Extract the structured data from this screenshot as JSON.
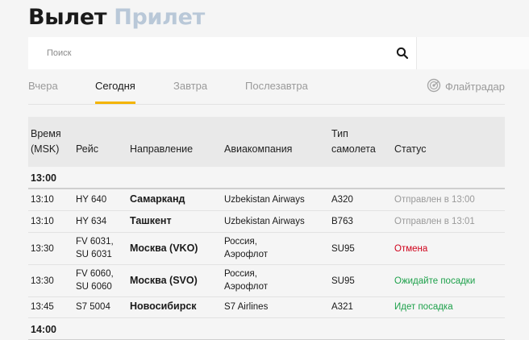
{
  "header": {
    "departures": "Вылет",
    "arrivals": "Прилет"
  },
  "search": {
    "placeholder": "Поиск"
  },
  "tabs": [
    {
      "label": "Вчера"
    },
    {
      "label": "Сегодня"
    },
    {
      "label": "Завтра"
    },
    {
      "label": "Послезавтра"
    }
  ],
  "flightradar": {
    "label": "Флайтрадар"
  },
  "table": {
    "columns": {
      "time_line1": "Время",
      "time_line2": "(MSK)",
      "flight": "Рейс",
      "destination": "Направление",
      "airline": "Авиакомпания",
      "aircraft_line1": "Тип",
      "aircraft_line2": "самолета",
      "status": "Статус"
    },
    "groups": [
      {
        "label": "13:00"
      },
      {
        "label": "14:00"
      }
    ],
    "rows": [
      {
        "time": "13:10",
        "flight_1": "HY 640",
        "flight_2": "",
        "destination": "Самарканд",
        "airline_1": "Uzbekistan Airways",
        "airline_2": "",
        "aircraft": "A320",
        "status": "Отправлен в 13:00"
      },
      {
        "time": "13:10",
        "flight_1": "HY 634",
        "flight_2": "",
        "destination": "Ташкент",
        "airline_1": "Uzbekistan Airways",
        "airline_2": "",
        "aircraft": "B763",
        "status": "Отправлен в 13:01"
      },
      {
        "time": "13:30",
        "flight_1": "FV 6031,",
        "flight_2": "SU 6031",
        "destination": "Москва (VKO)",
        "airline_1": "Россия,",
        "airline_2": "Аэрофлот",
        "aircraft": "SU95",
        "status": "Отмена"
      },
      {
        "time": "13:30",
        "flight_1": "FV 6060,",
        "flight_2": "SU 6060",
        "destination": "Москва (SVO)",
        "airline_1": "Россия,",
        "airline_2": "Аэрофлот",
        "aircraft": "SU95",
        "status": "Ожидайте посадки"
      },
      {
        "time": "13:45",
        "flight_1": "S7 5004",
        "flight_2": "",
        "destination": "Новосибирск",
        "airline_1": "S7 Airlines",
        "airline_2": "",
        "aircraft": "A321",
        "status": "Идет посадка"
      }
    ]
  },
  "colors": {
    "accent": "#f4b400",
    "status_departed": "#9a9a9a",
    "status_cancelled": "#d0021b",
    "status_ok": "#1ea14b"
  },
  "icons": [
    "search-icon",
    "flightradar-icon"
  ]
}
